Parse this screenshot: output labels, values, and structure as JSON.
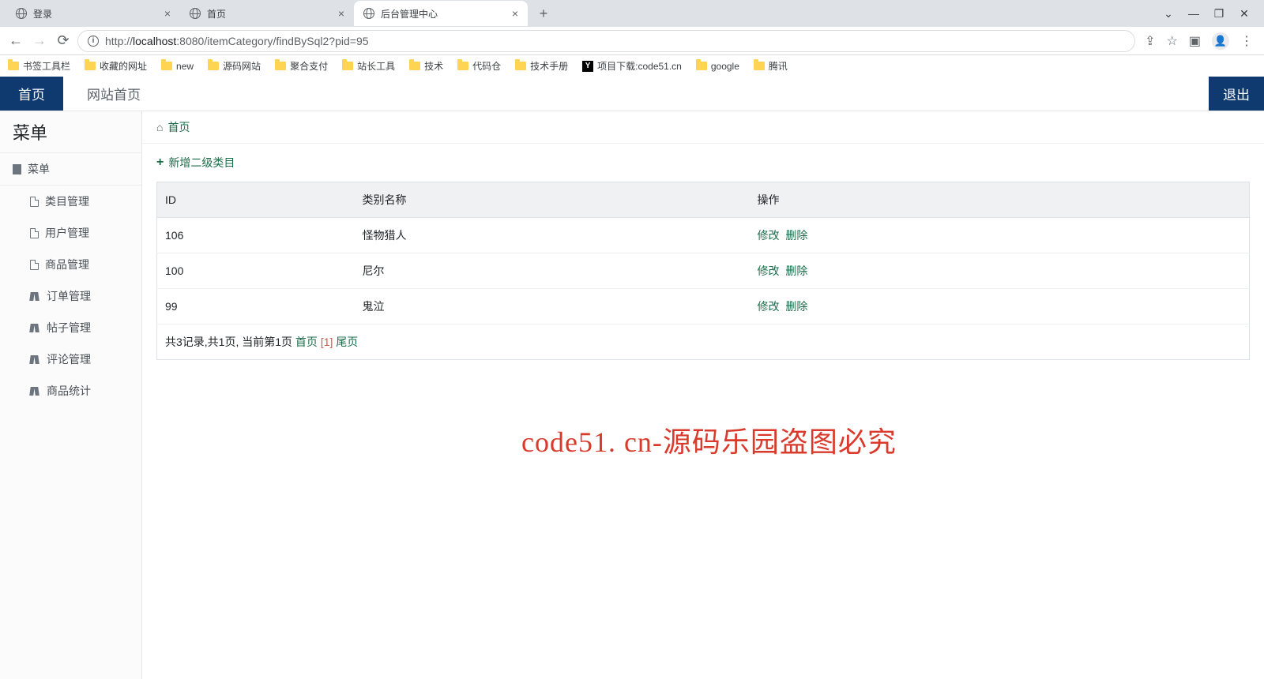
{
  "browser": {
    "tabs": [
      {
        "title": "登录"
      },
      {
        "title": "首页"
      },
      {
        "title": "后台管理中心"
      }
    ],
    "url_proto": "http://",
    "url_host": "localhost",
    "url_rest": ":8080/itemCategory/findBySql2?pid=95",
    "bookmarks_folders": [
      "书签工具栏",
      "收藏的网址",
      "new",
      "源码网站",
      "聚合支付",
      "站长工具",
      "技术",
      "代码仓",
      "技术手册"
    ],
    "bookmarks_link": "项目下载:code51.cn",
    "bookmarks_folders2": [
      "google",
      "腾讯"
    ]
  },
  "header": {
    "home": "首页",
    "site": "网站首页",
    "logout": "退出"
  },
  "sidebar": {
    "title": "菜单",
    "root": "菜单",
    "items": [
      "类目管理",
      "用户管理",
      "商品管理",
      "订单管理",
      "帖子管理",
      "评论管理",
      "商品统计"
    ]
  },
  "main": {
    "breadcrumb": "首页",
    "add_label": "新增二级类目",
    "table": {
      "headers": [
        "ID",
        "类别名称",
        "操作"
      ],
      "rows": [
        {
          "id": "106",
          "name": "怪物猎人"
        },
        {
          "id": "100",
          "name": "尼尔"
        },
        {
          "id": "99",
          "name": "鬼泣"
        }
      ],
      "op_edit": "修改",
      "op_delete": "删除"
    },
    "pagination": {
      "summary": "共3记录,共1页, 当前第1页",
      "first": "首页",
      "current": "[1]",
      "last": "尾页"
    }
  },
  "watermark": "code51. cn-源码乐园盗图必究"
}
